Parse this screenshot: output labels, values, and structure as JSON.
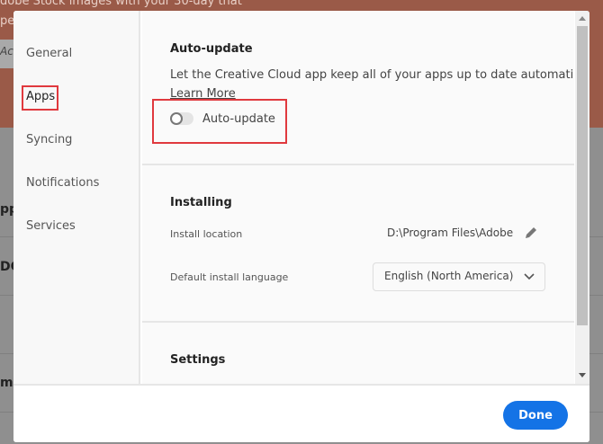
{
  "background": {
    "banner_text": "dobe Stock images with your 30-day that",
    "banner_text2": "per",
    "fragments": [
      "Ac",
      "pp",
      "DC",
      "m C"
    ]
  },
  "sidebar": {
    "items": [
      {
        "label": "General"
      },
      {
        "label": "Apps"
      },
      {
        "label": "Syncing"
      },
      {
        "label": "Notifications"
      },
      {
        "label": "Services"
      }
    ],
    "active": "Apps"
  },
  "autoupdate": {
    "title": "Auto-update",
    "description": "Let the Creative Cloud app keep all of your apps up to date automatically.",
    "learn_more": "Learn More",
    "toggle_label": "Auto-update",
    "toggle_on": false
  },
  "installing": {
    "title": "Installing",
    "location_label": "Install location",
    "location_value": "D:\\Program Files\\Adobe",
    "language_label": "Default install language",
    "language_value": "English (North America)"
  },
  "settings": {
    "title": "Settings"
  },
  "footer": {
    "done_label": "Done"
  },
  "colors": {
    "accent": "#1473e6",
    "highlight": "#e0393e"
  }
}
